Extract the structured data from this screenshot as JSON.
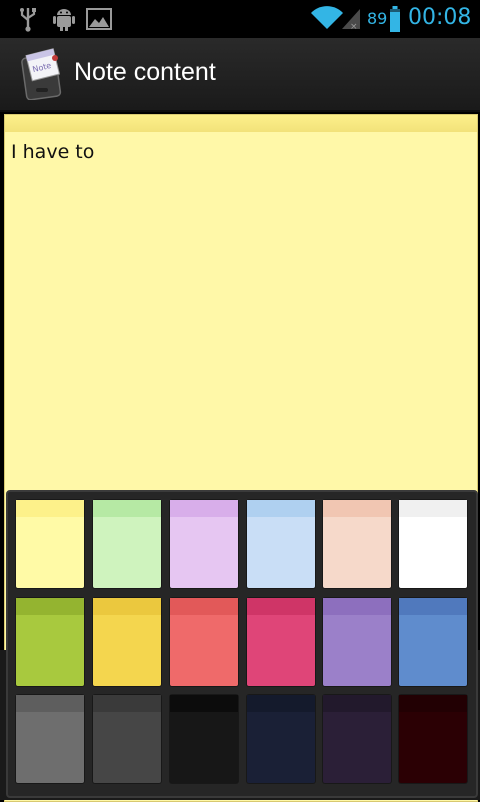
{
  "status_bar": {
    "battery_percent": "89",
    "time": "00:08",
    "icons": [
      "usb-icon",
      "android-debug-icon",
      "image-icon",
      "wifi-icon",
      "signal-icon",
      "battery-icon"
    ]
  },
  "action_bar": {
    "title": "Note content",
    "app_icon": "note-app-icon"
  },
  "note": {
    "text": "I have to",
    "color": "#fff8a8"
  },
  "palette": {
    "rows": [
      [
        {
          "name": "light-yellow",
          "color": "#fffaa6",
          "strip": "#fdf18a"
        },
        {
          "name": "light-green",
          "color": "#cff3be",
          "strip": "#b6e9a4"
        },
        {
          "name": "light-violet",
          "color": "#e6c6f2",
          "strip": "#d8aeea"
        },
        {
          "name": "light-blue",
          "color": "#c9def6",
          "strip": "#afd0f0"
        },
        {
          "name": "light-peach",
          "color": "#f6d9ca",
          "strip": "#f1c6b2"
        },
        {
          "name": "white",
          "color": "#ffffff",
          "strip": "#f0f0f0"
        }
      ],
      [
        {
          "name": "green",
          "color": "#a8c93e",
          "strip": "#94b430"
        },
        {
          "name": "yellow",
          "color": "#f4d64e",
          "strip": "#ebc83e"
        },
        {
          "name": "red",
          "color": "#ef6a6a",
          "strip": "#e25959"
        },
        {
          "name": "pink",
          "color": "#df4578",
          "strip": "#cf3567"
        },
        {
          "name": "purple",
          "color": "#9b80c9",
          "strip": "#8d6fbe"
        },
        {
          "name": "blue",
          "color": "#5f8ccd",
          "strip": "#5079bd"
        }
      ],
      [
        {
          "name": "gray",
          "color": "#6e6e6e",
          "strip": "#5e5e5e"
        },
        {
          "name": "dark-gray",
          "color": "#464646",
          "strip": "#3a3a3a"
        },
        {
          "name": "black",
          "color": "#171717",
          "strip": "#0c0c0c"
        },
        {
          "name": "navy",
          "color": "#1a2036",
          "strip": "#141a2c"
        },
        {
          "name": "dark-purple",
          "color": "#2b1f37",
          "strip": "#22192c"
        },
        {
          "name": "maroon",
          "color": "#2b0004",
          "strip": "#220003"
        }
      ]
    ]
  }
}
